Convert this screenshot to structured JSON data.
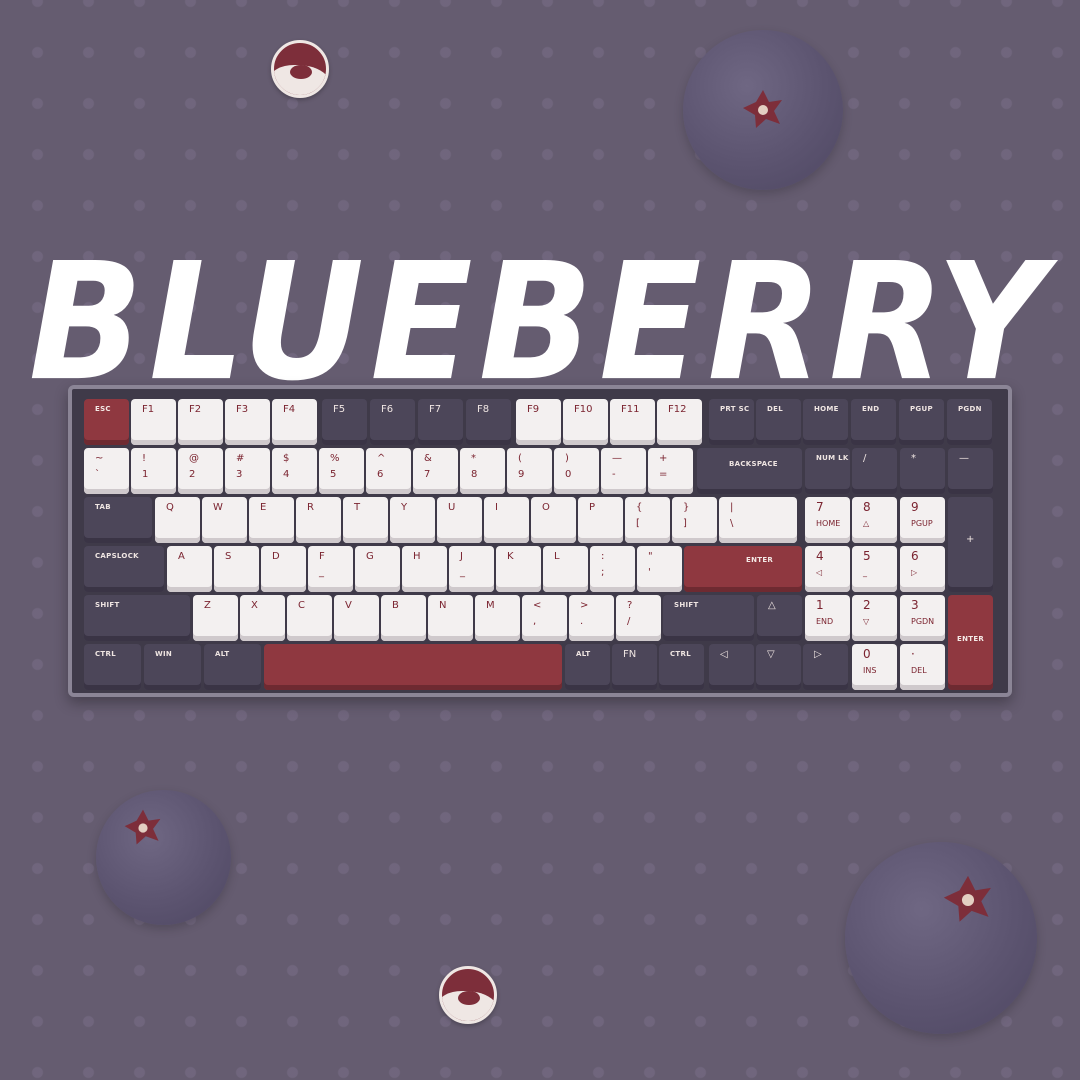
{
  "title": "BLUEBERRY",
  "colors": {
    "background": "#655c70",
    "key_white": "#f3f0f0",
    "key_dark": "#4c4659",
    "key_red": "#8f3840",
    "legend_red": "#7b2430"
  },
  "keyboard": {
    "rows": [
      {
        "keys": [
          {
            "legend": "ESC",
            "color": "r"
          },
          {
            "legend": "F1",
            "color": "w"
          },
          {
            "legend": "F2",
            "color": "w"
          },
          {
            "legend": "F3",
            "color": "w"
          },
          {
            "legend": "F4",
            "color": "w"
          },
          {
            "legend": "F5",
            "color": "d"
          },
          {
            "legend": "F6",
            "color": "d"
          },
          {
            "legend": "F7",
            "color": "d"
          },
          {
            "legend": "F8",
            "color": "d"
          },
          {
            "legend": "F9",
            "color": "w"
          },
          {
            "legend": "F10",
            "color": "w"
          },
          {
            "legend": "F11",
            "color": "w"
          },
          {
            "legend": "F12",
            "color": "w"
          },
          {
            "legend": "PRT SC",
            "color": "d"
          },
          {
            "legend": "DEL",
            "color": "d"
          },
          {
            "legend": "HOME",
            "color": "d"
          },
          {
            "legend": "END",
            "color": "d"
          },
          {
            "legend": "PGUP",
            "color": "d"
          },
          {
            "legend": "PGDN",
            "color": "d"
          }
        ]
      },
      {
        "keys": [
          {
            "legend": "~",
            "sub": "`",
            "color": "w"
          },
          {
            "legend": "!",
            "sub": "1",
            "color": "w"
          },
          {
            "legend": "@",
            "sub": "2",
            "color": "w"
          },
          {
            "legend": "#",
            "sub": "3",
            "color": "w"
          },
          {
            "legend": "$",
            "sub": "4",
            "color": "w"
          },
          {
            "legend": "%",
            "sub": "5",
            "color": "w"
          },
          {
            "legend": "^",
            "sub": "6",
            "color": "w"
          },
          {
            "legend": "&",
            "sub": "7",
            "color": "w"
          },
          {
            "legend": "*",
            "sub": "8",
            "color": "w"
          },
          {
            "legend": "(",
            "sub": "9",
            "color": "w"
          },
          {
            "legend": ")",
            "sub": "0",
            "color": "w"
          },
          {
            "legend": "—",
            "sub": "-",
            "color": "w"
          },
          {
            "legend": "+",
            "sub": "=",
            "color": "w"
          },
          {
            "legend": "BACKSPACE",
            "color": "d"
          },
          {
            "legend": "NUM LK",
            "color": "d"
          },
          {
            "legend": "/",
            "color": "d"
          },
          {
            "legend": "*",
            "color": "d"
          },
          {
            "legend": "—",
            "color": "d"
          }
        ]
      },
      {
        "keys": [
          {
            "legend": "TAB",
            "color": "d"
          },
          {
            "legend": "Q",
            "color": "w"
          },
          {
            "legend": "W",
            "color": "w"
          },
          {
            "legend": "E",
            "color": "w"
          },
          {
            "legend": "R",
            "color": "w"
          },
          {
            "legend": "T",
            "color": "w"
          },
          {
            "legend": "Y",
            "color": "w"
          },
          {
            "legend": "U",
            "color": "w"
          },
          {
            "legend": "I",
            "color": "w"
          },
          {
            "legend": "O",
            "color": "w"
          },
          {
            "legend": "P",
            "color": "w"
          },
          {
            "legend": "{",
            "sub": "[",
            "color": "w"
          },
          {
            "legend": "}",
            "sub": "]",
            "color": "w"
          },
          {
            "legend": "|",
            "sub": "\\",
            "color": "w"
          },
          {
            "legend": "7",
            "sub": "HOME",
            "color": "w"
          },
          {
            "legend": "8",
            "sub": "△",
            "color": "w"
          },
          {
            "legend": "9",
            "sub": "PGUP",
            "color": "w"
          },
          {
            "legend": "+",
            "color": "d"
          }
        ]
      },
      {
        "keys": [
          {
            "legend": "CAPSLOCK",
            "color": "d"
          },
          {
            "legend": "A",
            "color": "w"
          },
          {
            "legend": "S",
            "color": "w"
          },
          {
            "legend": "D",
            "color": "w"
          },
          {
            "legend": "F",
            "sub": "_",
            "color": "w"
          },
          {
            "legend": "G",
            "color": "w"
          },
          {
            "legend": "H",
            "color": "w"
          },
          {
            "legend": "J",
            "sub": "_",
            "color": "w"
          },
          {
            "legend": "K",
            "color": "w"
          },
          {
            "legend": "L",
            "color": "w"
          },
          {
            "legend": ":",
            "sub": ";",
            "color": "w"
          },
          {
            "legend": "\"",
            "sub": "'",
            "color": "w"
          },
          {
            "legend": "ENTER",
            "color": "r"
          },
          {
            "legend": "4",
            "sub": "◁",
            "color": "w"
          },
          {
            "legend": "5",
            "sub": "_",
            "color": "w"
          },
          {
            "legend": "6",
            "sub": "▷",
            "color": "w"
          }
        ]
      },
      {
        "keys": [
          {
            "legend": "SHIFT",
            "color": "d"
          },
          {
            "legend": "Z",
            "color": "w"
          },
          {
            "legend": "X",
            "color": "w"
          },
          {
            "legend": "C",
            "color": "w"
          },
          {
            "legend": "V",
            "color": "w"
          },
          {
            "legend": "B",
            "color": "w"
          },
          {
            "legend": "N",
            "color": "w"
          },
          {
            "legend": "M",
            "color": "w"
          },
          {
            "legend": "<",
            "sub": ",",
            "color": "w"
          },
          {
            "legend": ">",
            "sub": ".",
            "color": "w"
          },
          {
            "legend": "?",
            "sub": "/",
            "color": "w"
          },
          {
            "legend": "SHIFT",
            "color": "d"
          },
          {
            "legend": "△",
            "color": "d"
          },
          {
            "legend": "1",
            "sub": "END",
            "color": "w"
          },
          {
            "legend": "2",
            "sub": "▽",
            "color": "w"
          },
          {
            "legend": "3",
            "sub": "PGDN",
            "color": "w"
          },
          {
            "legend": "ENTER",
            "color": "r"
          }
        ]
      },
      {
        "keys": [
          {
            "legend": "CTRL",
            "color": "d"
          },
          {
            "legend": "WIN",
            "color": "d"
          },
          {
            "legend": "ALT",
            "color": "d"
          },
          {
            "legend": "",
            "color": "r"
          },
          {
            "legend": "ALT",
            "color": "d"
          },
          {
            "legend": "FN",
            "color": "d"
          },
          {
            "legend": "CTRL",
            "color": "d"
          },
          {
            "legend": "◁",
            "color": "d"
          },
          {
            "legend": "▽",
            "color": "d"
          },
          {
            "legend": "▷",
            "color": "d"
          },
          {
            "legend": "0",
            "sub": "INS",
            "color": "w"
          },
          {
            "legend": "·",
            "sub": "DEL",
            "color": "w"
          }
        ]
      }
    ]
  }
}
